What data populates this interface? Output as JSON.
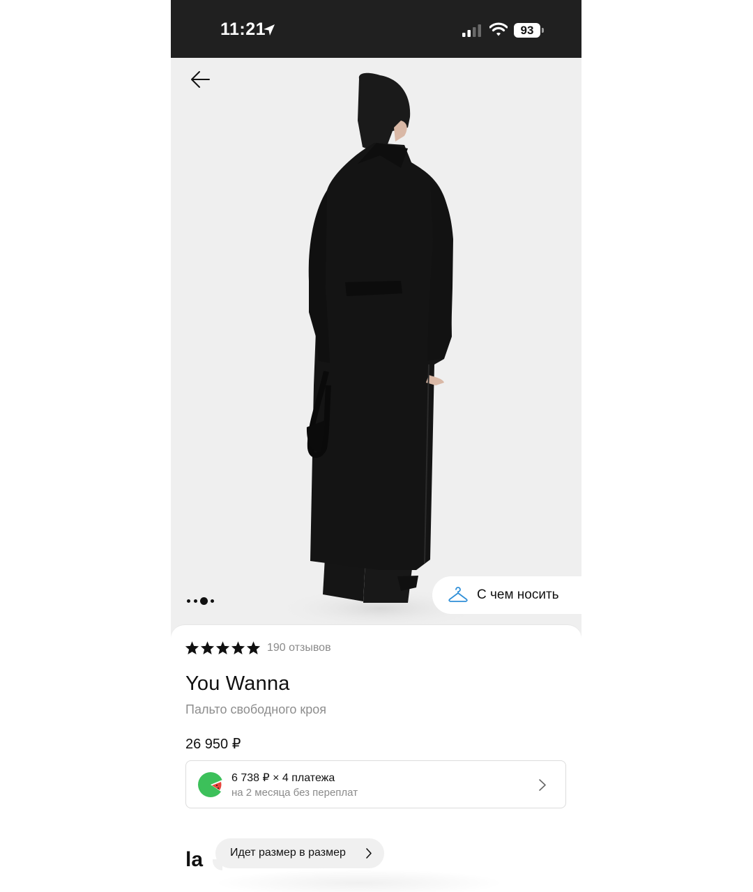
{
  "status_bar": {
    "time": "11:21",
    "battery": "93",
    "icons": [
      "location-arrow-icon",
      "signal-icon",
      "wifi-icon",
      "battery-icon"
    ]
  },
  "hero": {
    "icons": [
      "back-arrow-icon"
    ],
    "carousel": {
      "count": 3,
      "active_index": 2
    },
    "wear_button_label": "С чем носить",
    "wear_icon": "hanger-icon"
  },
  "product": {
    "rating": 5,
    "reviews": "190 отзывов",
    "brand": "You Wanna",
    "name": "Пальто свободного кроя",
    "price": "26 950 ₽"
  },
  "installment": {
    "main": "6 738 ₽ × 4 платежа",
    "sub": "на 2 месяца без переплат",
    "icon": "split-payment-logo-icon"
  },
  "size_section": {
    "title_fragment": "la",
    "pill_label": "Идет размер в размер"
  },
  "colors": {
    "status_bar_bg": "#202020",
    "hero_bg": "#efefef",
    "garment": "#141414",
    "accent_hanger": "#2f8fd8",
    "logo_green": "#3cc05a",
    "logo_red": "#e8453c"
  }
}
